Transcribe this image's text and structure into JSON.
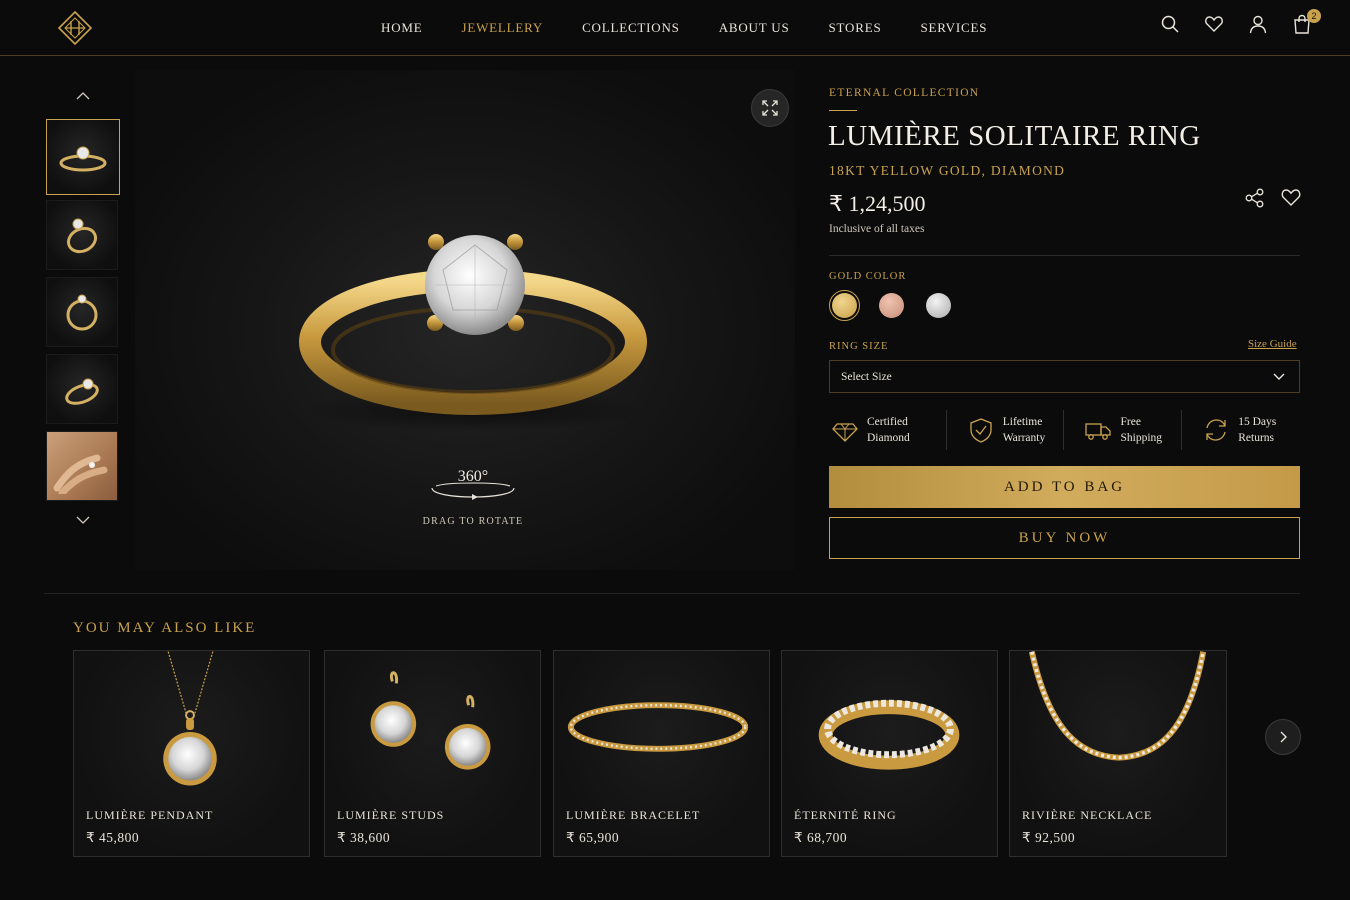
{
  "nav": {
    "items": [
      {
        "label": "HOME",
        "active": false
      },
      {
        "label": "JEWELLERY",
        "active": true
      },
      {
        "label": "COLLECTIONS",
        "active": false
      },
      {
        "label": "ABOUT US",
        "active": false
      },
      {
        "label": "STORES",
        "active": false
      },
      {
        "label": "SERVICES",
        "active": false
      }
    ],
    "cart_count": "2"
  },
  "product": {
    "collection": "ETERNAL COLLECTION",
    "title": "LUMIÈRE SOLITAIRE RING",
    "subtitle": "18KT YELLOW GOLD, DIAMOND",
    "price": "₹ 1,24,500",
    "tax_note": "Inclusive of all taxes",
    "rotate_label": "360°",
    "drag_label": "DRAG TO ROTATE",
    "gold_color_label": "GOLD COLOR",
    "gold_colors": [
      {
        "name": "yellow-gold",
        "hex": "#d7b45e",
        "selected": true
      },
      {
        "name": "rose-gold",
        "hex": "#d9a48e",
        "selected": false
      },
      {
        "name": "white-gold",
        "hex": "#d4d4d4",
        "selected": false
      }
    ],
    "ring_size_label": "RING SIZE",
    "size_guide": "Size Guide",
    "size_select": "Select Size",
    "features": [
      {
        "icon": "diamond-icon",
        "line1": "Certified",
        "line2": "Diamond"
      },
      {
        "icon": "shield-check-icon",
        "line1": "Lifetime",
        "line2": "Warranty"
      },
      {
        "icon": "truck-icon",
        "line1": "Free",
        "line2": "Shipping"
      },
      {
        "icon": "refresh-icon",
        "line1": "15 Days",
        "line2": "Returns"
      }
    ],
    "add_to_bag": "ADD TO BAG",
    "buy_now": "BUY NOW"
  },
  "recommendations": {
    "heading": "YOU MAY ALSO LIKE",
    "items": [
      {
        "name": "LUMIÈRE PENDANT",
        "price": "₹ 45,800"
      },
      {
        "name": "LUMIÈRE STUDS",
        "price": "₹ 38,600"
      },
      {
        "name": "LUMIÈRE BRACELET",
        "price": "₹ 65,900"
      },
      {
        "name": "ÉTERNITÉ RING",
        "price": "₹ 68,700"
      },
      {
        "name": "RIVIÈRE NECKLACE",
        "price": "₹ 92,500"
      }
    ]
  },
  "colors": {
    "accent": "#c9a24e",
    "background": "#0b0b0b"
  }
}
